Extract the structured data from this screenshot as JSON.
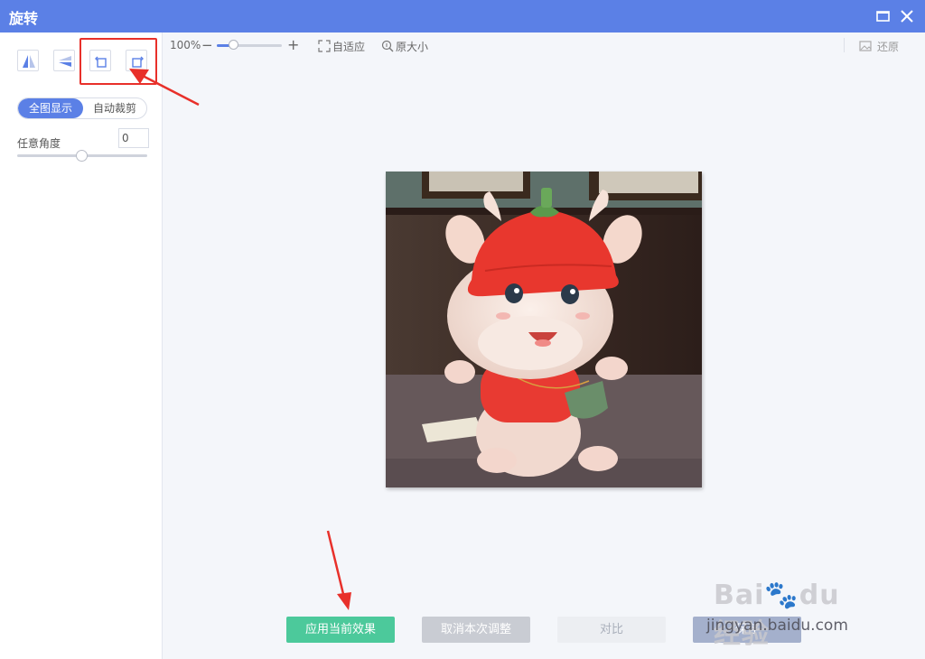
{
  "window": {
    "title": "旋转"
  },
  "left_panel": {
    "tools": [
      {
        "name": "flip-horizontal",
        "icon": "flip-horizontal-icon"
      },
      {
        "name": "flip-vertical",
        "icon": "flip-vertical-icon"
      },
      {
        "name": "rotate-left",
        "icon": "rotate-left-icon"
      },
      {
        "name": "rotate-right",
        "icon": "rotate-right-icon"
      }
    ],
    "display_modes": {
      "active": "全图显示",
      "inactive": "自动裁剪"
    },
    "angle": {
      "label": "任意角度",
      "value": "0",
      "slider_fraction": 0.5
    }
  },
  "toolbar": {
    "zoom_percent": "100%",
    "zoom_minus": "−",
    "zoom_plus": "+",
    "fit_label": "自适应",
    "original_size_label": "原大小",
    "restore_label": "还原"
  },
  "actions": {
    "apply_label": "应用当前效果",
    "cancel_label": "取消本次调整",
    "compare_label": "对比",
    "save_label": "保存"
  },
  "watermark": {
    "logo_text": "Bai du 经验",
    "sub_text": "jingyan.baidu.com"
  },
  "colors": {
    "title_bar": "#5b80e6",
    "accent": "#5b80e6",
    "apply": "#4cc99b",
    "annotation": "#e8302a"
  }
}
